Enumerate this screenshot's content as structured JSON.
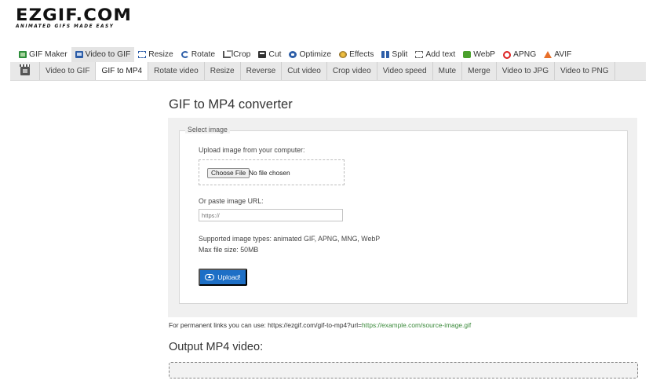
{
  "logo": {
    "name": "EZGIF.COM",
    "tagline": "ANIMATED GIFS MADE EASY"
  },
  "main_nav": [
    {
      "label": "GIF Maker",
      "icon": "gif-icon"
    },
    {
      "label": "Video to GIF",
      "icon": "video-icon",
      "active": true
    },
    {
      "label": "Resize",
      "icon": "resize-icon"
    },
    {
      "label": "Rotate",
      "icon": "rotate-icon"
    },
    {
      "label": "Crop",
      "icon": "crop-icon"
    },
    {
      "label": "Cut",
      "icon": "cut-icon"
    },
    {
      "label": "Optimize",
      "icon": "optimize-icon"
    },
    {
      "label": "Effects",
      "icon": "effects-icon"
    },
    {
      "label": "Split",
      "icon": "split-icon"
    },
    {
      "label": "Add text",
      "icon": "text-icon"
    },
    {
      "label": "WebP",
      "icon": "webp-icon"
    },
    {
      "label": "APNG",
      "icon": "apng-icon"
    },
    {
      "label": "AVIF",
      "icon": "avif-icon"
    }
  ],
  "sub_nav": [
    {
      "label": "Video to GIF"
    },
    {
      "label": "GIF to MP4",
      "active": true
    },
    {
      "label": "Rotate video"
    },
    {
      "label": "Resize"
    },
    {
      "label": "Reverse"
    },
    {
      "label": "Cut video"
    },
    {
      "label": "Crop video"
    },
    {
      "label": "Video speed"
    },
    {
      "label": "Mute"
    },
    {
      "label": "Merge"
    },
    {
      "label": "Video to JPG"
    },
    {
      "label": "Video to PNG"
    }
  ],
  "page": {
    "title": "GIF to MP4 converter"
  },
  "form": {
    "legend": "Select image",
    "upload_label": "Upload image from your computer:",
    "choose_button": "Choose File",
    "no_file": "No file chosen",
    "paste_label": "Or paste image URL:",
    "url_placeholder": "https://",
    "supported_types": "Supported image types: animated GIF, APNG, MNG, WebP",
    "max_size": "Max file size: 50MB",
    "upload_button": "Upload!"
  },
  "permanent": {
    "text": "For permanent links you can use: https://ezgif.com/gif-to-mp4?url=",
    "link": "https://example.com/source-image.gif"
  },
  "output": {
    "title": "Output MP4 video:"
  },
  "colors": {
    "upload_button": "#1d6fc6",
    "link": "#3b8a3b",
    "panel_bg": "#f0f0f0",
    "subnav_bg": "#e8e8e8"
  }
}
